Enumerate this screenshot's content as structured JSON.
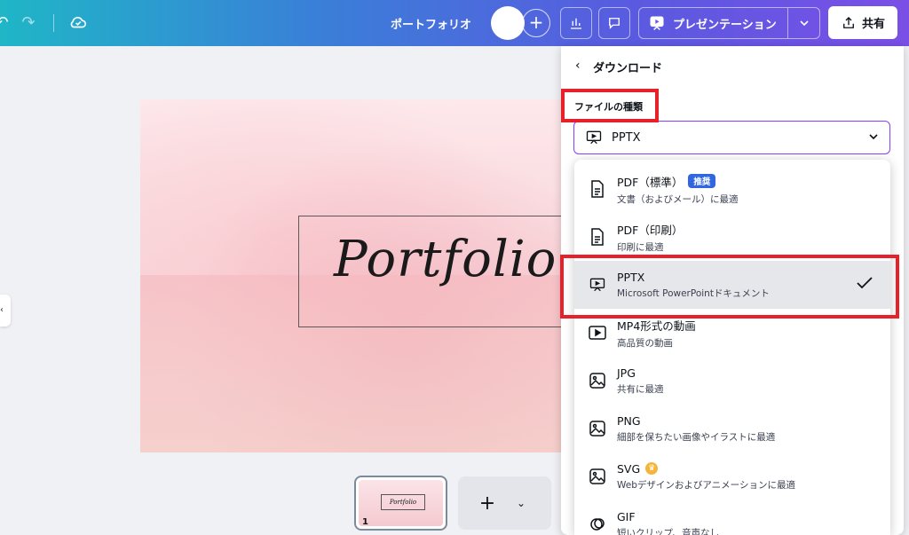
{
  "topbar": {
    "title": "ポートフォリオ",
    "present_label": "プレゼンテーション",
    "share_label": "共有",
    "plus": "+"
  },
  "slide": {
    "text": "Portfolio"
  },
  "thumbnail": {
    "text": "Portfolio",
    "page_number": "1"
  },
  "panel": {
    "back": "‹",
    "title": "ダウンロード",
    "file_type_label": "ファイルの種類",
    "selected_value": "PPTX"
  },
  "options": [
    {
      "name": "PDF（標準）",
      "desc": "文書（およびメール）に最適",
      "badge": "推奨",
      "icon": "document-icon"
    },
    {
      "name": "PDF（印刷）",
      "desc": "印刷に最適",
      "icon": "document-icon"
    },
    {
      "name": "PPTX",
      "desc": "Microsoft PowerPointドキュメント",
      "icon": "presentation-icon",
      "selected": true
    },
    {
      "name": "MP4形式の動画",
      "desc": "高品質の動画",
      "icon": "video-icon"
    },
    {
      "name": "JPG",
      "desc": "共有に最適",
      "icon": "image-icon"
    },
    {
      "name": "PNG",
      "desc": "細部を保ちたい画像やイラストに最適",
      "icon": "image-icon"
    },
    {
      "name": "SVG",
      "desc": "Webデザインおよびアニメーションに最適",
      "icon": "image-icon",
      "pro": true
    },
    {
      "name": "GIF",
      "desc": "短いクリップ、音声なし",
      "icon": "gif-icon"
    }
  ],
  "colors": {
    "accent": "#8b3dff",
    "highlight": "#e8202a",
    "badge": "#3066e0"
  }
}
